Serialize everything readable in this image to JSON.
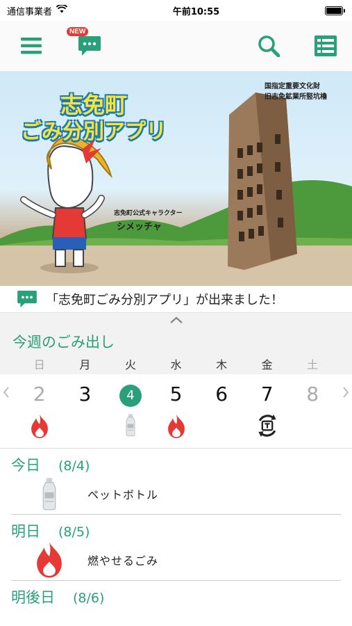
{
  "status_bar": {
    "carrier": "通信事業者",
    "time": "午前10:55"
  },
  "header": {
    "new_badge": "NEW"
  },
  "banner": {
    "title_line1": "志免町",
    "title_line2": "ごみ分別アプリ",
    "tower_note_line1": "国指定重要文化財",
    "tower_note_line2": "旧志免鉱業所竪坑櫓",
    "character_note": "志免町公式キャラクター",
    "character_name": "シメッチャ"
  },
  "news": {
    "text": "「志免町ごみ分別アプリ」が出来ました！"
  },
  "week": {
    "title": "今週のごみ出し",
    "weekdays": [
      "日",
      "月",
      "火",
      "水",
      "木",
      "金",
      "土"
    ],
    "dates": [
      "2",
      "3",
      "4",
      "5",
      "6",
      "7",
      "8"
    ],
    "today_index": 2,
    "icons": [
      "fire-icon",
      "",
      "bottle-icon",
      "fire-icon",
      "",
      "recycle-icon",
      ""
    ]
  },
  "schedule": [
    {
      "day": "今日",
      "date": "(8/4)",
      "items": [
        {
          "icon": "bottle-icon",
          "label": "ペットボトル"
        }
      ]
    },
    {
      "day": "明日",
      "date": "(8/5)",
      "items": [
        {
          "icon": "fire-icon",
          "label": "燃やせるごみ"
        }
      ]
    },
    {
      "day": "明後日",
      "date": "(8/6)",
      "items": []
    }
  ],
  "colors": {
    "accent": "#2aa07a",
    "fire": "#e53935",
    "badge": "#e53935"
  }
}
